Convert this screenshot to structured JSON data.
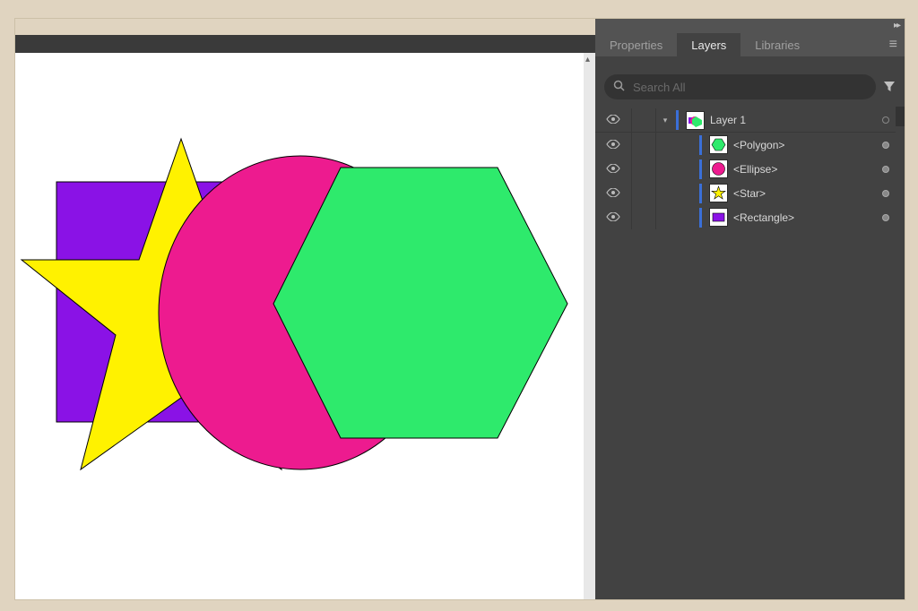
{
  "tabs": {
    "properties": "Properties",
    "layers": "Layers",
    "libraries": "Libraries"
  },
  "search": {
    "placeholder": "Search All"
  },
  "layer": {
    "name": "Layer 1"
  },
  "sublayers": {
    "polygon": "<Polygon>",
    "ellipse": "<Ellipse>",
    "star": "<Star>",
    "rectangle": "<Rectangle>"
  },
  "colors": {
    "polygon": "#2eea6c",
    "ellipse": "#ed1b8f",
    "star": "#fff200",
    "rectangle": "#8a12e6"
  }
}
